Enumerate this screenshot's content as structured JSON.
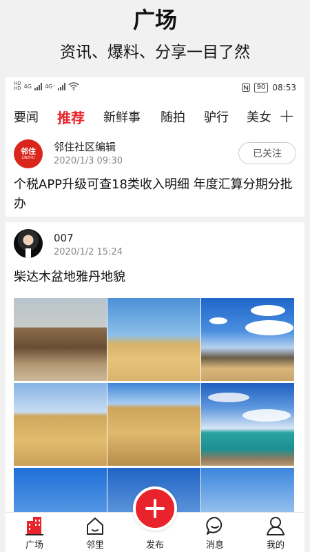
{
  "promo": {
    "title": "广场",
    "subtitle": "资讯、爆料、分享一目了然"
  },
  "status_bar": {
    "hd1": "HD",
    "hd2": "HD",
    "net1": "4G",
    "net2": "4G⁺",
    "battery": "90",
    "time": "08:53"
  },
  "tabs": [
    {
      "label": "要闻"
    },
    {
      "label": "推荐"
    },
    {
      "label": "新鲜事"
    },
    {
      "label": "随拍"
    },
    {
      "label": "驴行"
    },
    {
      "label": "美女"
    }
  ],
  "active_tab": "推荐",
  "posts": [
    {
      "author": "邻住社区编辑",
      "avatar_text": "邻住",
      "avatar_sub": "LINZHU",
      "date": "2020/1/3  09:30",
      "follow_label": "已关注",
      "title": "个税APP升级可查18类收入明细 年度汇算分期分批办"
    },
    {
      "author": "007",
      "date": "2020/1/2  15:24",
      "title": "柴达木盆地雅丹地貌"
    }
  ],
  "bottom_nav": [
    {
      "label": "广场",
      "icon": "building-icon",
      "active": true
    },
    {
      "label": "邻里",
      "icon": "home-icon"
    },
    {
      "label": "发布",
      "icon": "add-icon"
    },
    {
      "label": "消息",
      "icon": "message-icon"
    },
    {
      "label": "我的",
      "icon": "user-icon"
    }
  ],
  "colors": {
    "accent": "#e8232b",
    "text": "#222222",
    "muted": "#888888"
  }
}
